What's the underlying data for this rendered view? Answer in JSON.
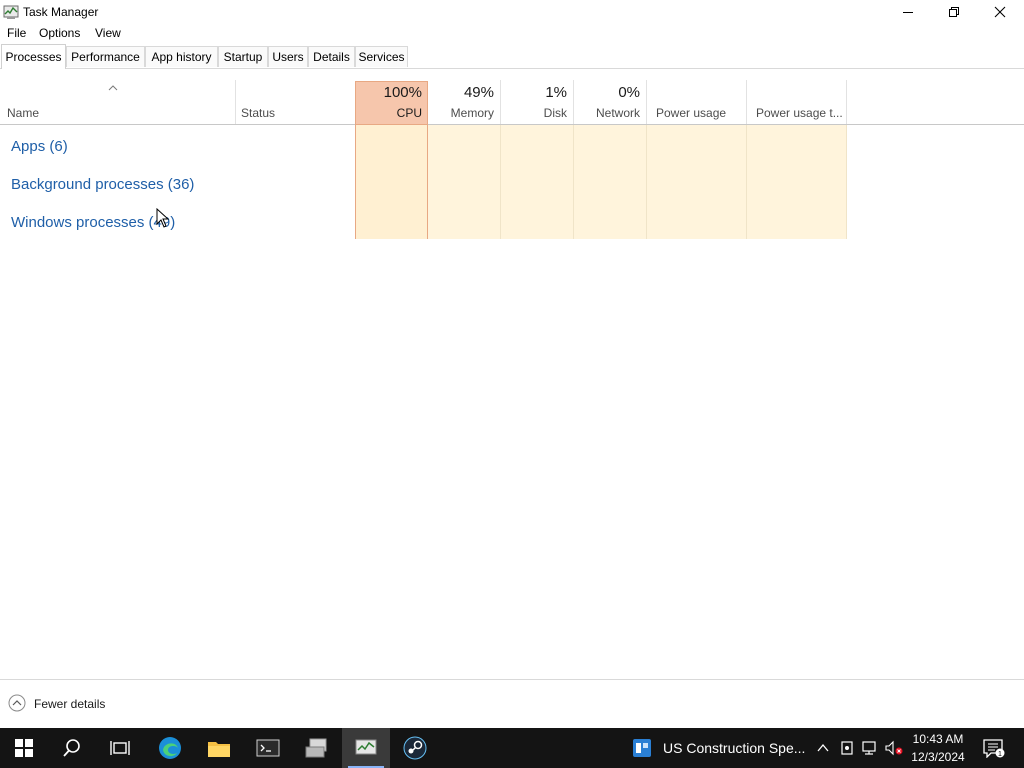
{
  "window": {
    "title": "Task Manager",
    "controls": {
      "minimize": "minimize",
      "restore": "restore",
      "close": "close"
    }
  },
  "menu": [
    "File",
    "Options",
    "View"
  ],
  "tabs": [
    {
      "label": "Processes",
      "active": true
    },
    {
      "label": "Performance"
    },
    {
      "label": "App history"
    },
    {
      "label": "Startup"
    },
    {
      "label": "Users"
    },
    {
      "label": "Details"
    },
    {
      "label": "Services"
    }
  ],
  "columns": {
    "name": "Name",
    "status": "Status",
    "cpu": {
      "pct": "100%",
      "label": "CPU"
    },
    "memory": {
      "pct": "49%",
      "label": "Memory"
    },
    "disk": {
      "pct": "1%",
      "label": "Disk"
    },
    "network": {
      "pct": "0%",
      "label": "Network"
    },
    "power": "Power usage",
    "power_trend": "Power usage t..."
  },
  "groups": [
    "Apps (6)",
    "Background processes (36)",
    "Windows processes (49)"
  ],
  "footer": {
    "fewer_details": "Fewer details"
  },
  "taskbar": {
    "notification_text": "US Construction Spe...",
    "time": "10:43 AM",
    "date": "12/3/2024"
  },
  "colors": {
    "cpu_header": "#f6c6ac",
    "cell_tint": "#fff4dc",
    "link_blue": "#1f5fa8",
    "taskbar": "#141414"
  }
}
